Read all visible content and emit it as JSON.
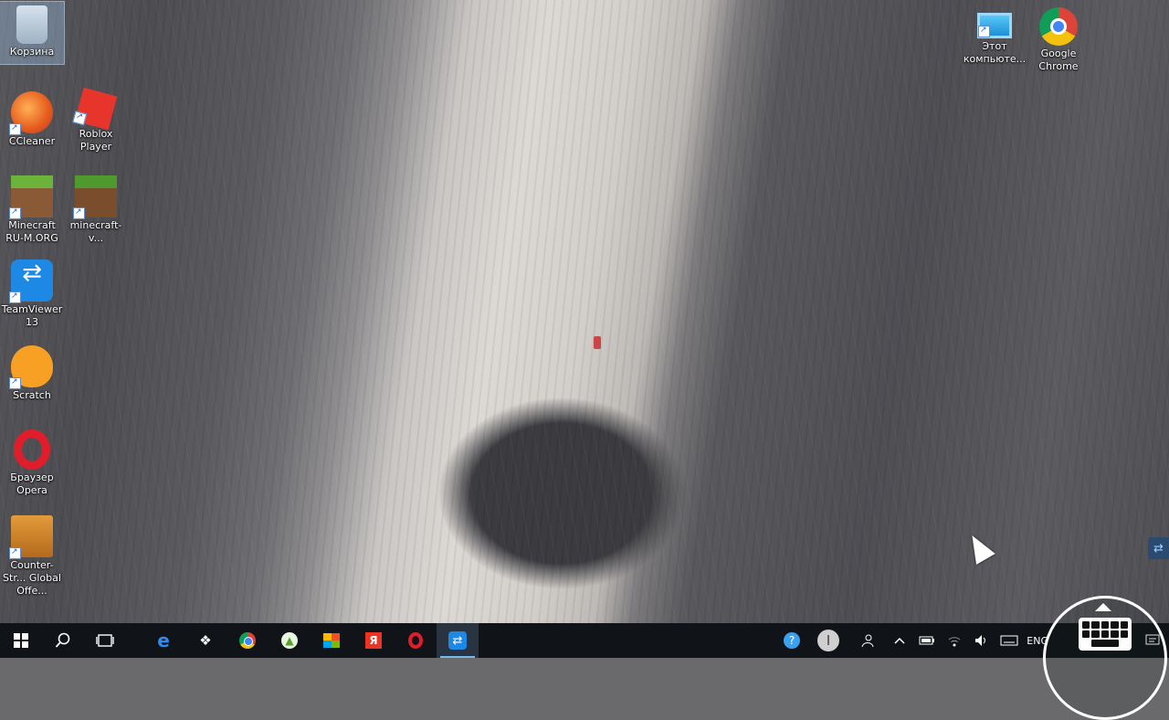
{
  "desktop": {
    "icons": [
      {
        "label": "Корзина",
        "icon": "recycle-bin-icon"
      },
      {
        "label": "CCleaner",
        "icon": "ccleaner-icon"
      },
      {
        "label": "Roblox Player",
        "icon": "roblox-icon"
      },
      {
        "label": "Minecraft RU-M.ORG",
        "icon": "minecraft-icon"
      },
      {
        "label": "minecraft-v...",
        "icon": "minecraft-icon"
      },
      {
        "label": "TeamViewer 13",
        "icon": "teamviewer-icon"
      },
      {
        "label": "Scratch",
        "icon": "scratch-icon"
      },
      {
        "label": "Браузер Opera",
        "icon": "opera-icon"
      },
      {
        "label": "Counter-Str... Global Offe...",
        "icon": "counter-strike-icon"
      },
      {
        "label": "Этот компьюте...",
        "icon": "this-pc-icon"
      },
      {
        "label": "Google Chrome",
        "icon": "chrome-icon"
      }
    ]
  },
  "taskbar": {
    "start": "start-icon",
    "search": "search-icon",
    "task_view": "task-view-icon",
    "pinned": [
      {
        "name": "edge-icon",
        "glyph": "e"
      },
      {
        "name": "dropbox-icon",
        "glyph": "❖"
      },
      {
        "name": "chrome-icon",
        "glyph": ""
      },
      {
        "name": "navigator-icon",
        "glyph": "▲"
      },
      {
        "name": "store-icon",
        "glyph": ""
      },
      {
        "name": "yandex-icon",
        "glyph": "Я"
      },
      {
        "name": "opera-icon",
        "glyph": ""
      },
      {
        "name": "teamviewer-icon",
        "glyph": "⇄"
      }
    ],
    "tray": {
      "language": "ENG",
      "icons": [
        "help-icon",
        "user-circle-icon",
        "people-icon",
        "chevron-up-icon",
        "battery-icon",
        "wifi-icon",
        "volume-icon",
        "keyboard-icon"
      ]
    }
  }
}
